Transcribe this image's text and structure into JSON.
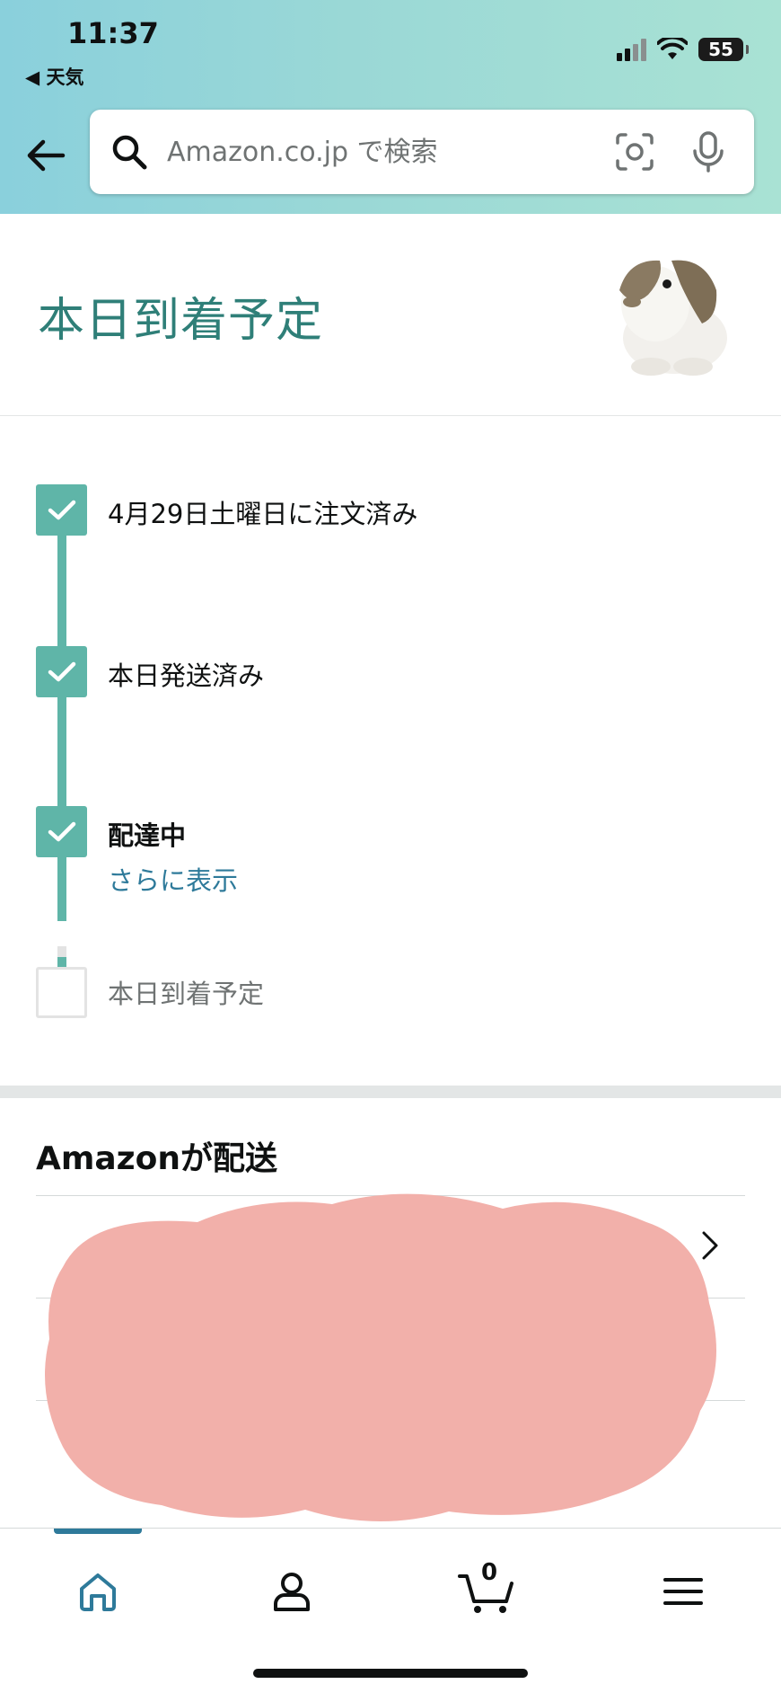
{
  "status_bar": {
    "time": "11:37",
    "back_app": "◀ 天気",
    "battery": "55"
  },
  "search": {
    "placeholder": "Amazon.co.jp で検索"
  },
  "page": {
    "title": "本日到着予定"
  },
  "tracker": {
    "steps": [
      {
        "label": "4月29日土曜日に注文済み",
        "done": true
      },
      {
        "label": "本日発送済み",
        "done": true
      },
      {
        "label": "配達中",
        "done": true,
        "link": "さらに表示"
      },
      {
        "label": "本日到着予定",
        "done": false
      }
    ]
  },
  "delivery": {
    "heading": "Amazonが配送"
  },
  "bottom_nav": {
    "cart_count": "0",
    "active": "home"
  },
  "colors": {
    "accent_teal": "#5fb5a8",
    "title_teal": "#2f7f78",
    "link_blue": "#2e7a9a",
    "header_gradient_start": "#8ad0dc",
    "header_gradient_end": "#a9e2d4"
  }
}
